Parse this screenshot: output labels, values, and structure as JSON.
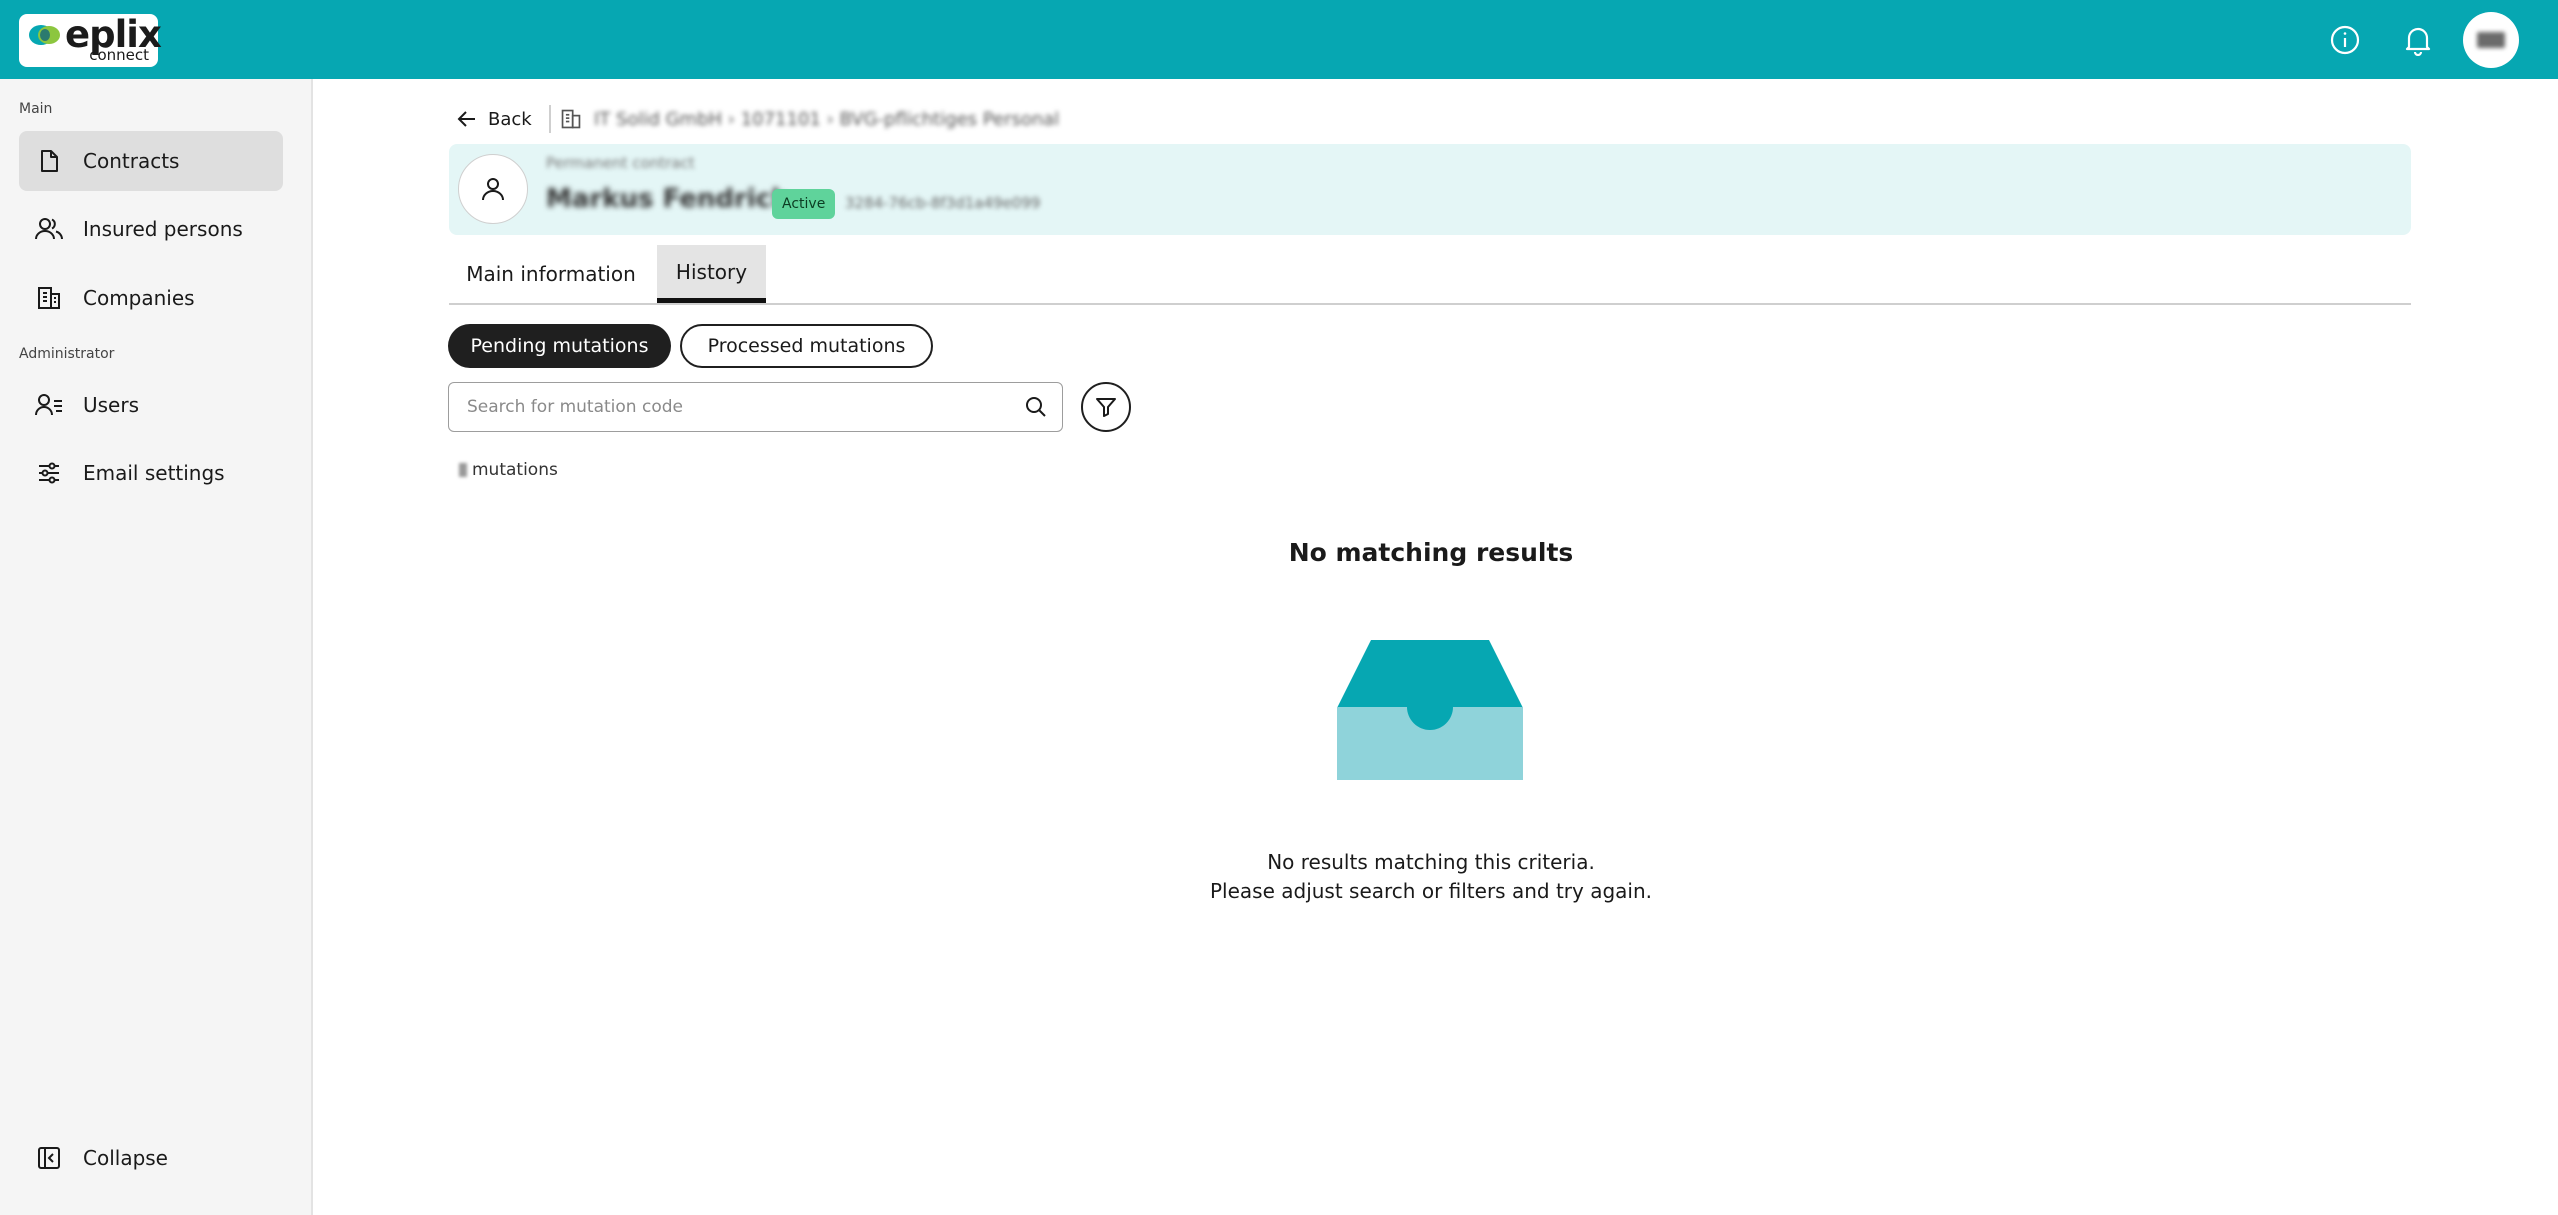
{
  "app": {
    "logo_text": "eplix",
    "logo_sub": "connect"
  },
  "colors": {
    "brand": "#06a7b2",
    "badge_active": "#5fd39b",
    "header_card_bg": "#e4f6f6"
  },
  "topbar": {
    "icons": [
      "info-icon",
      "bell-icon"
    ]
  },
  "sidebar": {
    "section_main": "Main",
    "section_admin": "Administrator",
    "items": [
      {
        "label": "Contracts",
        "icon": "document-icon",
        "active": true
      },
      {
        "label": "Insured persons",
        "icon": "people-icon"
      },
      {
        "label": "Companies",
        "icon": "building-icon"
      },
      {
        "label": "Users",
        "icon": "user-list-icon"
      },
      {
        "label": "Email settings",
        "icon": "sliders-icon"
      }
    ],
    "collapse_label": "Collapse"
  },
  "breadcrumb": {
    "back_label": "Back",
    "path_text": "IT Solid GmbH  ›  1071101  ›  BVG-pflichtiges Personal"
  },
  "person": {
    "subtitle": "Permanent contract",
    "name": "Markus Fendrich",
    "status": "Active",
    "id": "3284-76cb-8f3d1a49e099"
  },
  "tabs": [
    {
      "label": "Main information",
      "active": false
    },
    {
      "label": "History",
      "active": true
    }
  ],
  "mutation_tabs": {
    "pending": "Pending mutations",
    "processed": "Processed mutations"
  },
  "search": {
    "placeholder": "Search for mutation code",
    "value": ""
  },
  "results": {
    "count_label": "mutations"
  },
  "empty_state": {
    "title": "No matching results",
    "line1": "No results matching this criteria.",
    "line2": "Please adjust search or filters and try again."
  }
}
